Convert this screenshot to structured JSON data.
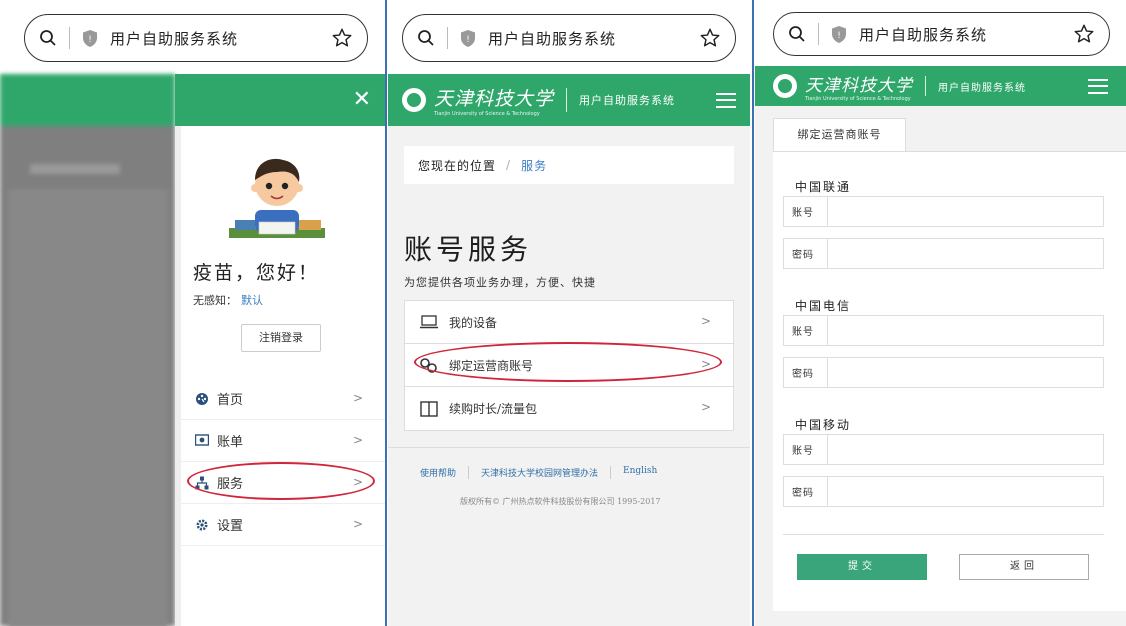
{
  "browser": {
    "address_title": "用户自助服务系统"
  },
  "header": {
    "university_name": "天津科技大学",
    "university_en": "Tianjin University of Science & Technology",
    "system_name": "用户自助服务系统"
  },
  "panel1": {
    "greeting": "疫苗，您好！",
    "senseless_label": "无感知：",
    "senseless_value": "默认",
    "logout_label": "注销登录",
    "menu": [
      {
        "label": "首页",
        "icon": "dashboard-icon"
      },
      {
        "label": "账单",
        "icon": "bill-icon"
      },
      {
        "label": "服务",
        "icon": "sitemap-icon"
      },
      {
        "label": "设置",
        "icon": "gear-icon"
      }
    ]
  },
  "panel2": {
    "breadcrumb_prefix": "您现在的位置",
    "breadcrumb_current": "服务",
    "title": "账号服务",
    "subtitle": "为您提供各项业务办理，方便、快捷",
    "services": [
      {
        "label": "我的设备",
        "icon": "laptop-icon"
      },
      {
        "label": "绑定运营商账号",
        "icon": "link-icon"
      },
      {
        "label": "续购时长/流量包",
        "icon": "columns-icon"
      }
    ],
    "footer_links": [
      "使用帮助",
      "天津科技大学校园网管理办法",
      "English"
    ],
    "copyright": "版权所有© 广州热点软件科技股份有限公司 1995-2017"
  },
  "panel3": {
    "tab_label": "绑定运营商账号",
    "operators": [
      {
        "name": "中国联通",
        "account_label": "账号",
        "password_label": "密码"
      },
      {
        "name": "中国电信",
        "account_label": "账号",
        "password_label": "密码"
      },
      {
        "name": "中国移动",
        "account_label": "账号",
        "password_label": "密码"
      }
    ],
    "submit_label": "提交",
    "back_label": "返回"
  },
  "colors": {
    "brand_green": "#2fa76b",
    "highlight_red": "#d0253a",
    "link_blue": "#3a7ec2"
  }
}
